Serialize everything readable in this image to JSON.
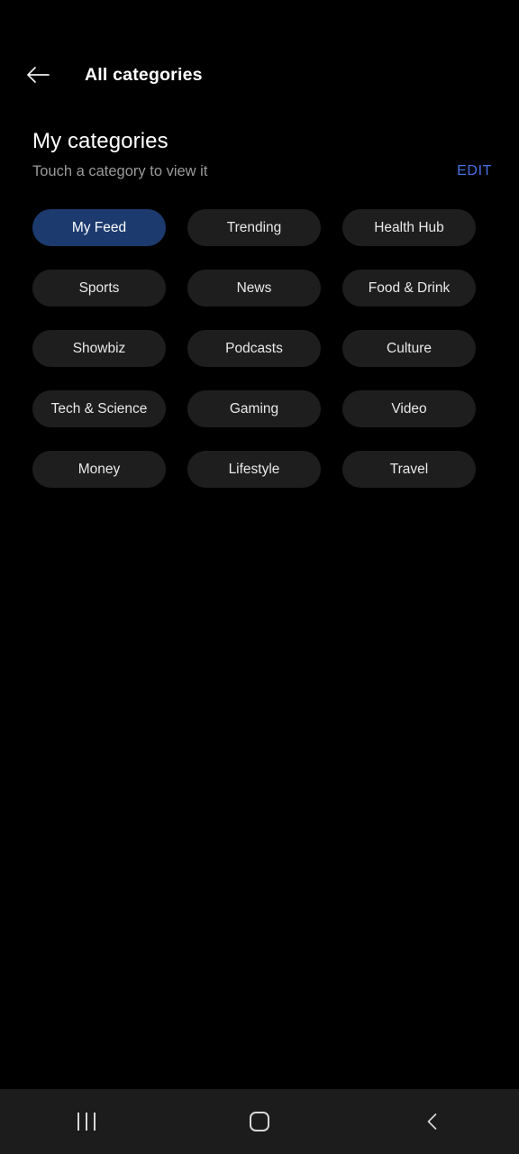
{
  "status_bar": {},
  "app_bar": {
    "back_icon": "arrow-left-icon",
    "title": "All categories"
  },
  "section": {
    "title": "My categories",
    "subtitle": "Touch a category to view it",
    "edit_label": "EDIT",
    "edit_color": "#4a6fe3"
  },
  "categories": [
    {
      "label": "My Feed",
      "selected": true
    },
    {
      "label": "Trending",
      "selected": false
    },
    {
      "label": "Health Hub",
      "selected": false
    },
    {
      "label": "Sports",
      "selected": false
    },
    {
      "label": "News",
      "selected": false
    },
    {
      "label": "Food & Drink",
      "selected": false
    },
    {
      "label": "Showbiz",
      "selected": false
    },
    {
      "label": "Podcasts",
      "selected": false
    },
    {
      "label": "Culture",
      "selected": false
    },
    {
      "label": "Tech & Science",
      "selected": false
    },
    {
      "label": "Gaming",
      "selected": false
    },
    {
      "label": "Video",
      "selected": false
    },
    {
      "label": "Money",
      "selected": false
    },
    {
      "label": "Lifestyle",
      "selected": false
    },
    {
      "label": "Travel",
      "selected": false
    }
  ],
  "chip_colors": {
    "selected_background": "#1c3a6e",
    "default_background": "#1e1e1e",
    "text": "#e8e8e8"
  },
  "nav_bar": {
    "background": "#1c1c1c",
    "buttons": [
      {
        "icon": "recents-icon"
      },
      {
        "icon": "home-icon"
      },
      {
        "icon": "back-chevron-icon"
      }
    ]
  }
}
